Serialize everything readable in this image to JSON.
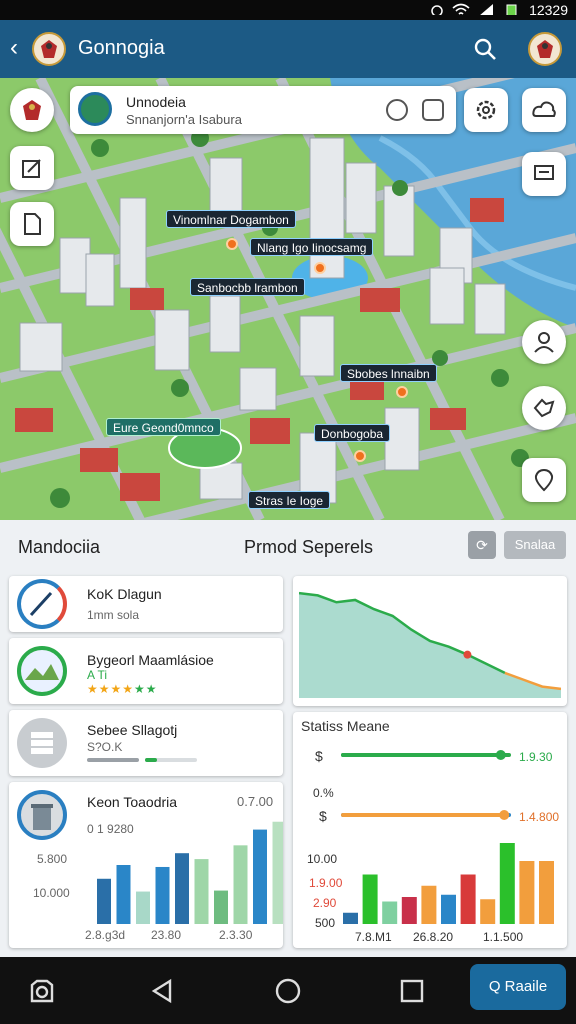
{
  "status_bar": {
    "time": "12329"
  },
  "app_bar": {
    "title": "Gonnogia"
  },
  "location_card": {
    "title": "Unnodeia",
    "subtitle": "Snnanjorn'a Isabura"
  },
  "map_labels": [
    "Vinomlnar Dogambon",
    "Nlang Igo Iinocsamg",
    "Sanbocbb lrambon",
    "Sbobes lnnaibn",
    "Eure Geond0mnco",
    "Donbogoba",
    "Stras Ie Ioge"
  ],
  "panel": {
    "left_title": "Mandociia",
    "right_title": "Prmod Seperels",
    "action_label": "Snalaa"
  },
  "list_items": [
    {
      "name": "KoK Dlagun",
      "sub": "1mm sola",
      "icon": "compass-icon",
      "accent": "#2a7fc1"
    },
    {
      "name": "Bygeorl Maamlásioe",
      "sub": "A Ti",
      "stars": "★★★★",
      "stars_green": "★★",
      "icon": "wheel-icon",
      "accent": "#2bab4b"
    },
    {
      "name": "Sebee Sllagotj",
      "sub": "S?O.K",
      "icon": "stack-icon",
      "accent": "#9aa0a6"
    },
    {
      "name": "Keon Toaodria",
      "sub": "0 1 9280",
      "icon": "building-icon",
      "accent": "#2a7fc1"
    }
  ],
  "chart_left": {
    "value_top": "0.7.00",
    "y_labels": [
      "5.800",
      "10.000"
    ],
    "x_labels": [
      "2.8.g3d",
      "23.80",
      "2.3.30"
    ]
  },
  "stats": {
    "title": "Statiss Meane",
    "row1": {
      "symbol": "$",
      "value": "1.9.30",
      "fill": 0.94,
      "color": "#2bab4b"
    },
    "row2_label": "0.%",
    "row3": {
      "symbol": "$",
      "value": "1.4.800",
      "fill": 0.96,
      "color": "#f29e3d"
    },
    "y_labels": [
      "10.00",
      "1.9.00",
      "2.90",
      "500"
    ],
    "x_labels": [
      "7.8.M1",
      "26.8.20",
      "1.1.500"
    ]
  },
  "chart_data": [
    {
      "type": "area",
      "title": "",
      "values": [
        92,
        90,
        84,
        86,
        78,
        72,
        60,
        50,
        45,
        38,
        30,
        22,
        16,
        10,
        8
      ],
      "ylim": [
        0,
        100
      ],
      "colors": {
        "line": "#2bab4b",
        "fill": "#8fcfbf",
        "tail": "#f29e3d"
      },
      "marker_index": 9
    },
    {
      "type": "bar",
      "title": "",
      "values": [
        46,
        60,
        33,
        58,
        72,
        66,
        34,
        80,
        96,
        104
      ],
      "colors": [
        "#2a6fa8",
        "#2a86c8",
        "#a8d8c8",
        "#2a86c8",
        "#2a6fa8",
        "#9fd6a8",
        "#6ebc80",
        "#9fd6a8",
        "#2a86c8",
        "#b8e0c0"
      ],
      "ylim": [
        0,
        120
      ]
    },
    {
      "type": "bar",
      "title": "",
      "values": [
        10,
        44,
        20,
        24,
        34,
        26,
        44,
        22,
        72,
        56,
        56
      ],
      "colors": [
        "#2a6fa8",
        "#2bc02b",
        "#7fd0a0",
        "#c8304a",
        "#f29e3d",
        "#2a86c8",
        "#d83a3a",
        "#f29e3d",
        "#2bc02b",
        "#f29e3d",
        "#f29e3d"
      ],
      "ylim": [
        0,
        80
      ]
    }
  ],
  "bottom_nav": {
    "route_label": "Q Raaile"
  }
}
